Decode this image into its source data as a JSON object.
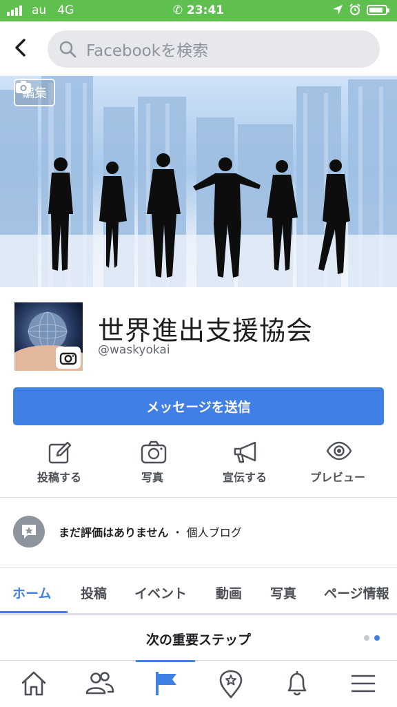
{
  "status_bar": {
    "carrier": "au",
    "network": "4G",
    "time": "23:41",
    "battery_level": 0.85
  },
  "search": {
    "placeholder": "Facebookを検索"
  },
  "cover": {
    "edit_label": "編集"
  },
  "page": {
    "name": "世界進出支援協会",
    "handle": "@waskyokai"
  },
  "message_button": "メッセージを送信",
  "actions": [
    {
      "label": "投稿する",
      "icon": "edit-icon"
    },
    {
      "label": "写真",
      "icon": "camera-icon"
    },
    {
      "label": "宣伝する",
      "icon": "megaphone-icon"
    },
    {
      "label": "プレビュー",
      "icon": "eye-icon"
    }
  ],
  "rating": {
    "text": "まだ評価はありません",
    "separator": "・",
    "category": "個人ブログ"
  },
  "tabs": [
    {
      "label": "ホーム",
      "active": true
    },
    {
      "label": "投稿"
    },
    {
      "label": "イベント"
    },
    {
      "label": "動画"
    },
    {
      "label": "写真"
    },
    {
      "label": "ページ情報"
    }
  ],
  "next_steps": {
    "title": "次の重要ステップ"
  },
  "bottom_nav": [
    {
      "icon": "home-icon"
    },
    {
      "icon": "friends-icon"
    },
    {
      "icon": "pages-flag-icon",
      "active": true
    },
    {
      "icon": "location-star-icon"
    },
    {
      "icon": "bell-icon"
    },
    {
      "icon": "menu-icon"
    }
  ],
  "colors": {
    "status_bar": "#5fbf4f",
    "accent": "#4080e4",
    "icon": "#4b4f56"
  }
}
